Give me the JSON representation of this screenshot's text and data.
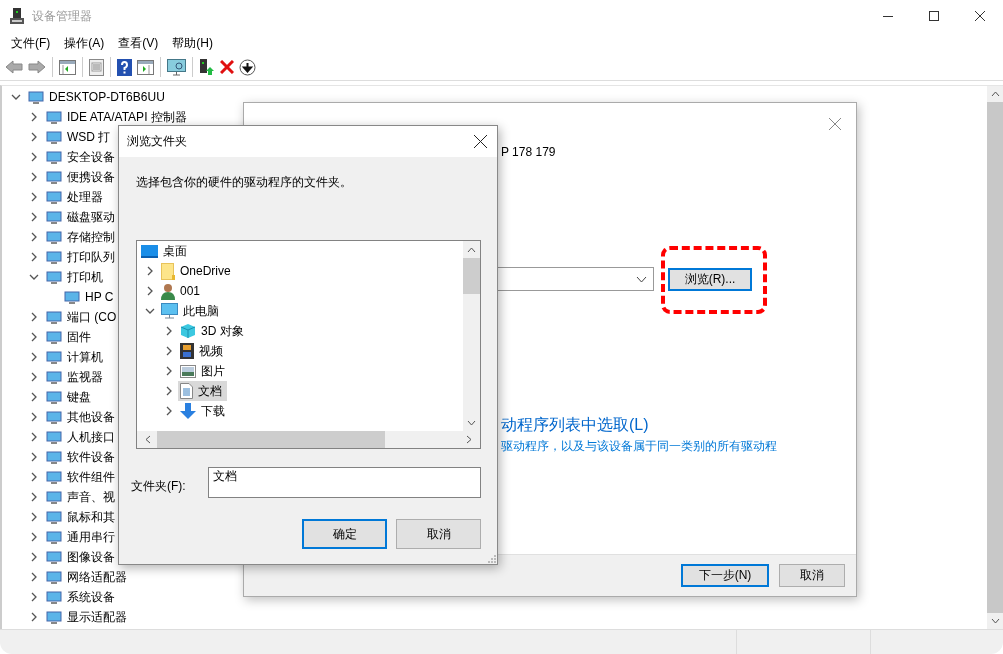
{
  "window": {
    "title": "设备管理器"
  },
  "menu": [
    "文件(F)",
    "操作(A)",
    "查看(V)",
    "帮助(H)"
  ],
  "device_tree": {
    "label": "DESKTOP-DT6B6UU",
    "expanded": true,
    "children": [
      {
        "label": "IDE ATA/ATAPI 控制器",
        "expanded": false
      },
      {
        "label": "WSD 打",
        "expanded": false
      },
      {
        "label": "安全设备",
        "expanded": false
      },
      {
        "label": "便携设备",
        "expanded": false
      },
      {
        "label": "处理器",
        "expanded": false
      },
      {
        "label": "磁盘驱动",
        "expanded": false
      },
      {
        "label": "存储控制",
        "expanded": false
      },
      {
        "label": "打印队列",
        "expanded": false
      },
      {
        "label": "打印机",
        "expanded": true,
        "children": [
          {
            "label": "HP C"
          }
        ]
      },
      {
        "label": "端口 (CO",
        "expanded": false
      },
      {
        "label": "固件",
        "expanded": false
      },
      {
        "label": "计算机",
        "expanded": false
      },
      {
        "label": "监视器",
        "expanded": false
      },
      {
        "label": "键盘",
        "expanded": false
      },
      {
        "label": "其他设备",
        "expanded": false
      },
      {
        "label": "人机接口",
        "expanded": false
      },
      {
        "label": "软件设备",
        "expanded": false
      },
      {
        "label": "软件组件",
        "expanded": false
      },
      {
        "label": "声音、视",
        "expanded": false
      },
      {
        "label": "鼠标和其",
        "expanded": false
      },
      {
        "label": "通用串行",
        "expanded": false
      },
      {
        "label": "图像设备",
        "expanded": false
      },
      {
        "label": "网络适配器",
        "expanded": false
      },
      {
        "label": "系统设备",
        "expanded": false
      },
      {
        "label": "显示适配器",
        "expanded": false
      }
    ]
  },
  "wizard": {
    "fragment": "P 178 179",
    "browse_button": "浏览(R)...",
    "highlighted": true,
    "link": "动程序列表中选取(L)",
    "link_note": "驱动程序，以及与该设备属于同一类别的所有驱动程",
    "buttons": [
      {
        "label": "下一步(N)",
        "default": true
      },
      {
        "label": "取消",
        "default": false
      }
    ]
  },
  "browse_dialog": {
    "title": "浏览文件夹",
    "prompt": "选择包含你的硬件的驱动程序的文件夹。",
    "folders": [
      {
        "label": "桌面",
        "kind": "desktop",
        "selected": false,
        "children": [
          {
            "label": "OneDrive",
            "kind": "folder",
            "expanded": false,
            "selected": false
          },
          {
            "label": "001",
            "kind": "user",
            "expanded": false,
            "selected": false
          },
          {
            "label": "此电脑",
            "kind": "computer",
            "expanded": true,
            "selected": false,
            "children": [
              {
                "label": "3D 对象",
                "kind": "cube",
                "expanded": false,
                "selected": false
              },
              {
                "label": "视频",
                "kind": "video",
                "expanded": false,
                "selected": false
              },
              {
                "label": "图片",
                "kind": "pictures",
                "expanded": false,
                "selected": false
              },
              {
                "label": "文档",
                "kind": "documents",
                "expanded": false,
                "selected": true
              },
              {
                "label": "下载",
                "kind": "downloads",
                "expanded": false,
                "selected": false
              }
            ]
          }
        ]
      }
    ],
    "folder_field": {
      "label": "文件夹(F):",
      "value": "文档"
    },
    "buttons": [
      {
        "label": "确定",
        "default": true
      },
      {
        "label": "取消",
        "default": false
      }
    ]
  }
}
